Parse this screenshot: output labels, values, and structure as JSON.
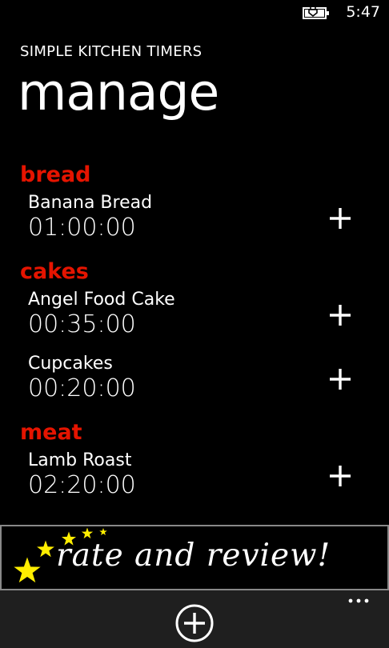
{
  "status_bar": {
    "time": "5:47",
    "battery_icon": "battery-charging-icon"
  },
  "app": {
    "title": "SIMPLE KITCHEN TIMERS"
  },
  "page": {
    "title": "manage"
  },
  "categories": [
    {
      "name": "bread",
      "timers": [
        {
          "name": "Banana Bread",
          "duration": "01:00:00"
        }
      ]
    },
    {
      "name": "cakes",
      "timers": [
        {
          "name": "Angel Food Cake",
          "duration": "00:35:00"
        },
        {
          "name": "Cupcakes",
          "duration": "00:20:00"
        }
      ]
    },
    {
      "name": "meat",
      "timers": [
        {
          "name": "Lamb Roast",
          "duration": "02:20:00"
        }
      ]
    }
  ],
  "banner": {
    "text": "rate and review!",
    "star_icon": "star-icon"
  },
  "app_bar": {
    "add_icon": "add-circle-icon",
    "more_icon": "ellipsis-icon"
  },
  "colors": {
    "background": "#000000",
    "accent": "#e51400",
    "app_bar": "#1f1f1f",
    "star": "#ffee00"
  }
}
